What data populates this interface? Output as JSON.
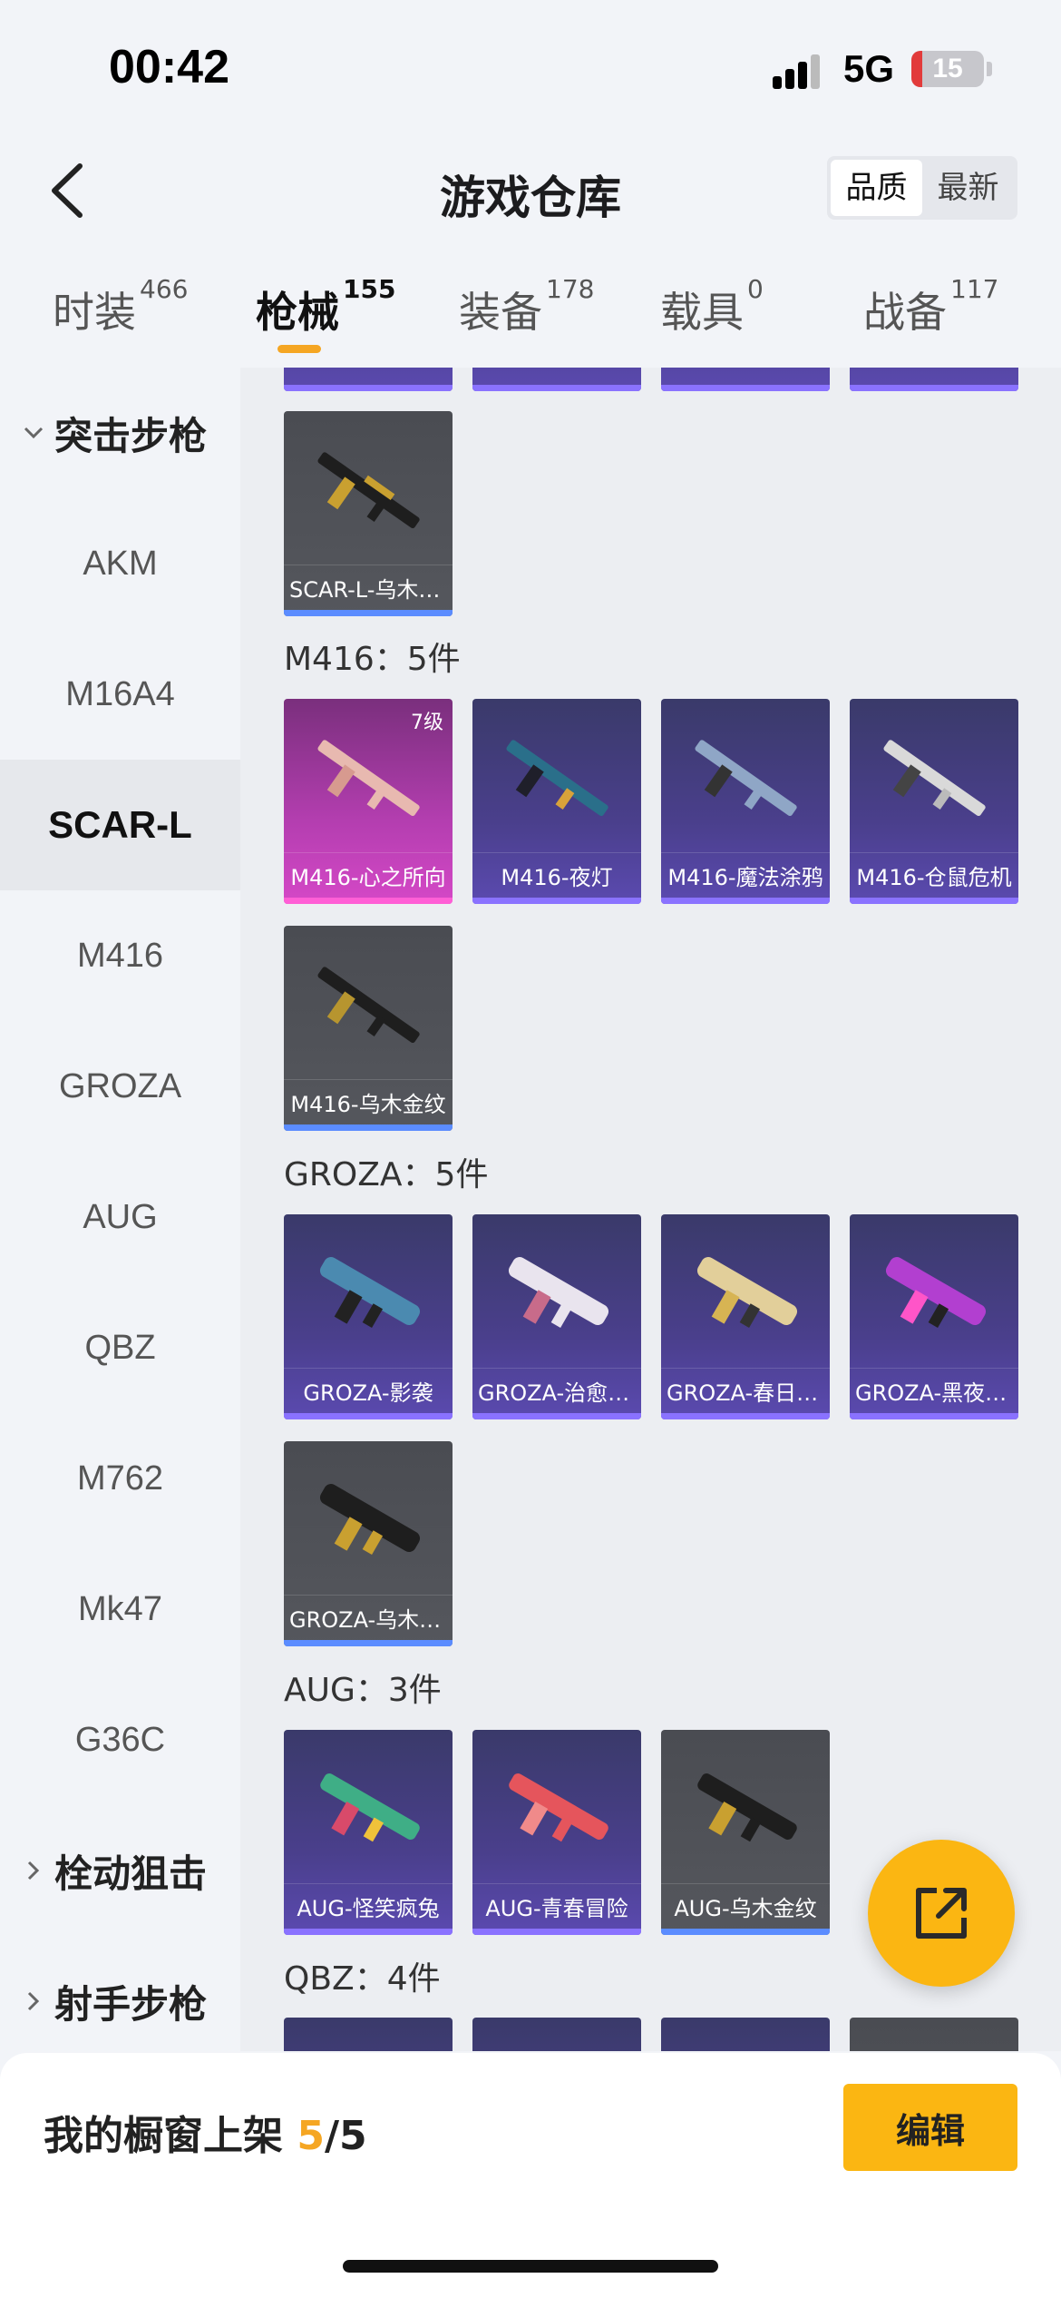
{
  "status": {
    "time": "00:42",
    "network": "5G",
    "battery": "15",
    "battery_level": 0.15
  },
  "nav": {
    "title": "游戏仓库",
    "sort_options": [
      "品质",
      "最新"
    ],
    "sort_selected": "品质"
  },
  "tabs": [
    {
      "label": "时装",
      "count": "466"
    },
    {
      "label": "枪械",
      "count": "155"
    },
    {
      "label": "装备",
      "count": "178"
    },
    {
      "label": "载具",
      "count": "0"
    },
    {
      "label": "战备",
      "count": "117"
    }
  ],
  "sidebar": {
    "group_assault": "突击步枪",
    "items": [
      "AKM",
      "M16A4",
      "SCAR-L",
      "M416",
      "GROZA",
      "AUG",
      "QBZ",
      "M762",
      "Mk47",
      "G36C"
    ],
    "group_bolt": "栓动狙击",
    "group_marksman": "射手步枪"
  },
  "sections": {
    "scar_top": {
      "item": {
        "label": "SCAR-L-乌木金纹"
      }
    },
    "m416": {
      "title": "M416：5件",
      "items": [
        {
          "label": "M416-心之所向",
          "grade": "7级"
        },
        {
          "label": "M416-夜灯"
        },
        {
          "label": "M416-魔法涂鸦"
        },
        {
          "label": "M416-仓鼠危机"
        },
        {
          "label": "M416-乌木金纹"
        }
      ]
    },
    "groza": {
      "title": "GROZA：5件",
      "items": [
        {
          "label": "GROZA-影袭"
        },
        {
          "label": "GROZA-治愈之心"
        },
        {
          "label": "GROZA-春日花语"
        },
        {
          "label": "GROZA-黑夜霓虹"
        },
        {
          "label": "GROZA-乌木金纹"
        }
      ]
    },
    "aug": {
      "title": "AUG：3件",
      "items": [
        {
          "label": "AUG-怪笑疯兔"
        },
        {
          "label": "AUG-青春冒险"
        },
        {
          "label": "AUG-乌木金纹"
        }
      ]
    },
    "qbz": {
      "title": "QBZ：4件"
    }
  },
  "bottom": {
    "text_prefix": "我的橱窗上架 ",
    "count_current": "5",
    "count_total": "/5",
    "edit_label": "编辑"
  },
  "colors": {
    "accent": "#fbb612",
    "purple_card": "#4a3f8c",
    "pink_card": "#b43eb0",
    "gray_card": "#4f5157"
  }
}
